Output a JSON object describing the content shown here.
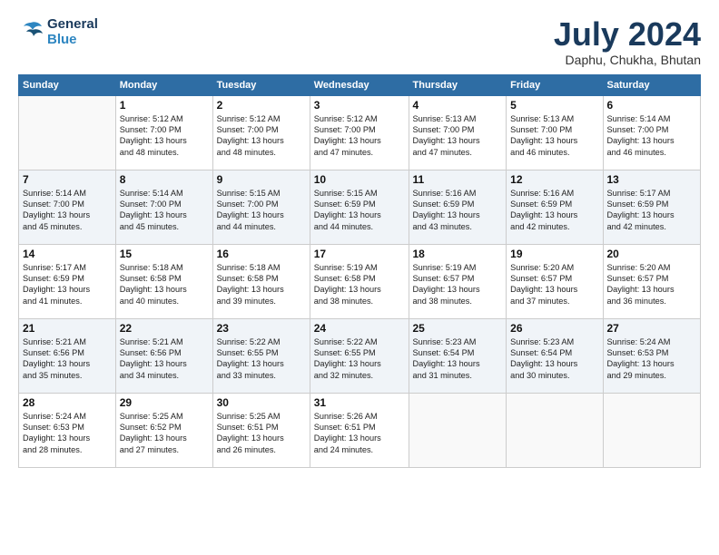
{
  "header": {
    "logo_line1": "General",
    "logo_line2": "Blue",
    "title": "July 2024",
    "subtitle": "Daphu, Chukha, Bhutan"
  },
  "weekdays": [
    "Sunday",
    "Monday",
    "Tuesday",
    "Wednesday",
    "Thursday",
    "Friday",
    "Saturday"
  ],
  "weeks": [
    [
      {
        "day": "",
        "info": ""
      },
      {
        "day": "1",
        "info": "Sunrise: 5:12 AM\nSunset: 7:00 PM\nDaylight: 13 hours\nand 48 minutes."
      },
      {
        "day": "2",
        "info": "Sunrise: 5:12 AM\nSunset: 7:00 PM\nDaylight: 13 hours\nand 48 minutes."
      },
      {
        "day": "3",
        "info": "Sunrise: 5:12 AM\nSunset: 7:00 PM\nDaylight: 13 hours\nand 47 minutes."
      },
      {
        "day": "4",
        "info": "Sunrise: 5:13 AM\nSunset: 7:00 PM\nDaylight: 13 hours\nand 47 minutes."
      },
      {
        "day": "5",
        "info": "Sunrise: 5:13 AM\nSunset: 7:00 PM\nDaylight: 13 hours\nand 46 minutes."
      },
      {
        "day": "6",
        "info": "Sunrise: 5:14 AM\nSunset: 7:00 PM\nDaylight: 13 hours\nand 46 minutes."
      }
    ],
    [
      {
        "day": "7",
        "info": "Sunrise: 5:14 AM\nSunset: 7:00 PM\nDaylight: 13 hours\nand 45 minutes."
      },
      {
        "day": "8",
        "info": "Sunrise: 5:14 AM\nSunset: 7:00 PM\nDaylight: 13 hours\nand 45 minutes."
      },
      {
        "day": "9",
        "info": "Sunrise: 5:15 AM\nSunset: 7:00 PM\nDaylight: 13 hours\nand 44 minutes."
      },
      {
        "day": "10",
        "info": "Sunrise: 5:15 AM\nSunset: 6:59 PM\nDaylight: 13 hours\nand 44 minutes."
      },
      {
        "day": "11",
        "info": "Sunrise: 5:16 AM\nSunset: 6:59 PM\nDaylight: 13 hours\nand 43 minutes."
      },
      {
        "day": "12",
        "info": "Sunrise: 5:16 AM\nSunset: 6:59 PM\nDaylight: 13 hours\nand 42 minutes."
      },
      {
        "day": "13",
        "info": "Sunrise: 5:17 AM\nSunset: 6:59 PM\nDaylight: 13 hours\nand 42 minutes."
      }
    ],
    [
      {
        "day": "14",
        "info": "Sunrise: 5:17 AM\nSunset: 6:59 PM\nDaylight: 13 hours\nand 41 minutes."
      },
      {
        "day": "15",
        "info": "Sunrise: 5:18 AM\nSunset: 6:58 PM\nDaylight: 13 hours\nand 40 minutes."
      },
      {
        "day": "16",
        "info": "Sunrise: 5:18 AM\nSunset: 6:58 PM\nDaylight: 13 hours\nand 39 minutes."
      },
      {
        "day": "17",
        "info": "Sunrise: 5:19 AM\nSunset: 6:58 PM\nDaylight: 13 hours\nand 38 minutes."
      },
      {
        "day": "18",
        "info": "Sunrise: 5:19 AM\nSunset: 6:57 PM\nDaylight: 13 hours\nand 38 minutes."
      },
      {
        "day": "19",
        "info": "Sunrise: 5:20 AM\nSunset: 6:57 PM\nDaylight: 13 hours\nand 37 minutes."
      },
      {
        "day": "20",
        "info": "Sunrise: 5:20 AM\nSunset: 6:57 PM\nDaylight: 13 hours\nand 36 minutes."
      }
    ],
    [
      {
        "day": "21",
        "info": "Sunrise: 5:21 AM\nSunset: 6:56 PM\nDaylight: 13 hours\nand 35 minutes."
      },
      {
        "day": "22",
        "info": "Sunrise: 5:21 AM\nSunset: 6:56 PM\nDaylight: 13 hours\nand 34 minutes."
      },
      {
        "day": "23",
        "info": "Sunrise: 5:22 AM\nSunset: 6:55 PM\nDaylight: 13 hours\nand 33 minutes."
      },
      {
        "day": "24",
        "info": "Sunrise: 5:22 AM\nSunset: 6:55 PM\nDaylight: 13 hours\nand 32 minutes."
      },
      {
        "day": "25",
        "info": "Sunrise: 5:23 AM\nSunset: 6:54 PM\nDaylight: 13 hours\nand 31 minutes."
      },
      {
        "day": "26",
        "info": "Sunrise: 5:23 AM\nSunset: 6:54 PM\nDaylight: 13 hours\nand 30 minutes."
      },
      {
        "day": "27",
        "info": "Sunrise: 5:24 AM\nSunset: 6:53 PM\nDaylight: 13 hours\nand 29 minutes."
      }
    ],
    [
      {
        "day": "28",
        "info": "Sunrise: 5:24 AM\nSunset: 6:53 PM\nDaylight: 13 hours\nand 28 minutes."
      },
      {
        "day": "29",
        "info": "Sunrise: 5:25 AM\nSunset: 6:52 PM\nDaylight: 13 hours\nand 27 minutes."
      },
      {
        "day": "30",
        "info": "Sunrise: 5:25 AM\nSunset: 6:51 PM\nDaylight: 13 hours\nand 26 minutes."
      },
      {
        "day": "31",
        "info": "Sunrise: 5:26 AM\nSunset: 6:51 PM\nDaylight: 13 hours\nand 24 minutes."
      },
      {
        "day": "",
        "info": ""
      },
      {
        "day": "",
        "info": ""
      },
      {
        "day": "",
        "info": ""
      }
    ]
  ]
}
